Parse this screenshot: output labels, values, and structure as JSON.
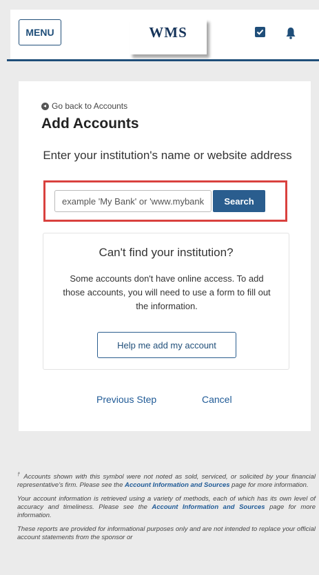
{
  "header": {
    "menu_label": "MENU",
    "logo_text": "WMS",
    "icons": [
      "check-square-icon",
      "bell-icon"
    ],
    "accent_color": "#1f4e79"
  },
  "main": {
    "back_link": "Go back to Accounts",
    "title": "Add Accounts",
    "instruction": "Enter your institution's name or website address",
    "search": {
      "placeholder": "example 'My Bank' or 'www.mybank.com'",
      "button_label": "Search",
      "highlight_color": "#d9413e"
    },
    "cant_find": {
      "title": "Can't find your institution?",
      "body": "Some accounts don't have online access. To add those accounts, you will need to use a form to fill out the information.",
      "button_label": "Help me add my account"
    },
    "previous_step": "Previous Step",
    "cancel": "Cancel"
  },
  "footer": {
    "note1_symbol": "†",
    "note1_text": " Accounts shown with this symbol were not noted as sold, serviced, or solicited by your financial representative's firm. Please see the ",
    "note1_link": "Account Information and Sources",
    "note1_after": " page for more information.",
    "note2_text": "Your account information is retrieved using a variety of methods, each of which has its own level of accuracy and timeliness. Please see the ",
    "note2_link": "Account Information and Sources",
    "note2_after": " page for more information.",
    "note3_text": "These reports are provided for informational purposes only and are not intended to replace your official account statements from the sponsor or"
  }
}
